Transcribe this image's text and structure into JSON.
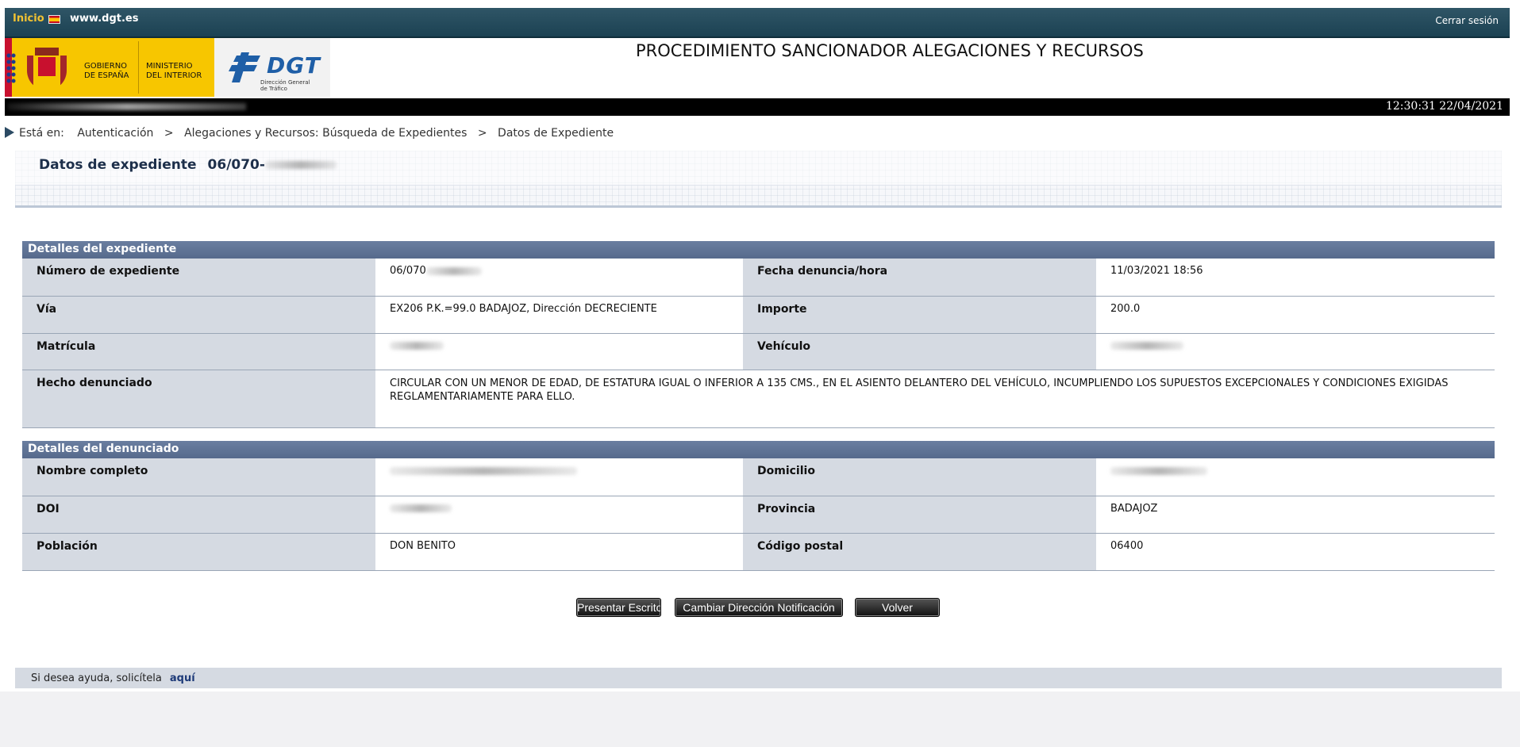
{
  "topbar": {
    "home_label": "Inicio",
    "site_label": "www.dgt.es",
    "logout_label": "Cerrar sesión"
  },
  "header": {
    "gov_line1": "GOBIERNO",
    "gov_line2": "DE ESPAÑA",
    "min_line1": "MINISTERIO",
    "min_line2": "DEL INTERIOR",
    "dgt_logo_text": "DGT",
    "dgt_sub1": "Dirección General",
    "dgt_sub2": "de Tráfico",
    "page_title": "PROCEDIMIENTO SANCIONADOR ALEGACIONES Y RECURSOS"
  },
  "status": {
    "datetime": "12:30:31 22/04/2021"
  },
  "breadcrumb": {
    "prefix": "Está en:",
    "items": [
      "Autenticación",
      "Alegaciones y Recursos: Búsqueda de Expedientes",
      "Datos de Expediente"
    ],
    "separator": ">"
  },
  "expediente": {
    "title": "Datos de expediente",
    "number_prefix": "06/070-"
  },
  "details": {
    "heading": "Detalles del expediente",
    "numero_label": "Número de expediente",
    "numero_value": "06/070",
    "fecha_label": "Fecha denuncia/hora",
    "fecha_value": "11/03/2021 18:56",
    "via_label": "Vía",
    "via_value": "EX206 P.K.=99.0 BADAJOZ, Dirección DECRECIENTE",
    "importe_label": "Importe",
    "importe_value": "200.0",
    "matricula_label": "Matrícula",
    "vehiculo_label": "Vehículo",
    "hecho_label": "Hecho denunciado",
    "hecho_value": "CIRCULAR CON UN MENOR DE EDAD, DE ESTATURA IGUAL O INFERIOR A 135 CMS., EN EL ASIENTO DELANTERO DEL VEHÍCULO, INCUMPLIENDO LOS SUPUESTOS EXCEPCIONALES Y CONDICIONES EXIGIDAS REGLAMENTARIAMENTE PARA ELLO."
  },
  "denunciado": {
    "heading": "Detalles del denunciado",
    "nombre_label": "Nombre completo",
    "domicilio_label": "Domicilio",
    "doi_label": "DOI",
    "provincia_label": "Provincia",
    "provincia_value": "BADAJOZ",
    "poblacion_label": "Población",
    "poblacion_value": "DON BENITO",
    "cp_label": "Código postal",
    "cp_value": "06400"
  },
  "actions": {
    "presentar_label": "Presentar Escrito",
    "cambiar_label": "Cambiar Dirección Notificación",
    "volver_label": "Volver"
  },
  "footer": {
    "help_text": "Si desea ayuda, solicítela",
    "help_link": "aquí"
  },
  "colors": {
    "topbar": "#1c4253",
    "section_header": "#5f7395",
    "label_cell": "#d5dae2"
  }
}
